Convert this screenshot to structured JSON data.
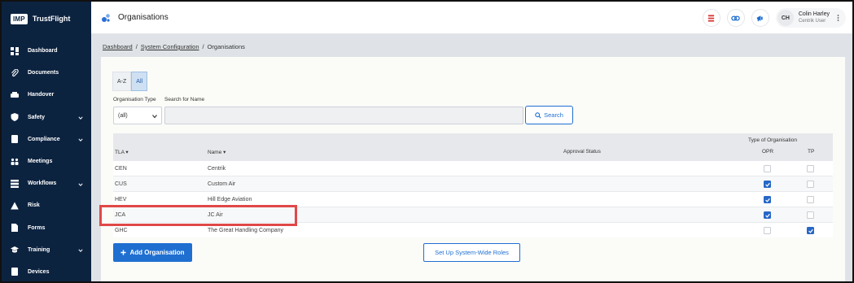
{
  "brand": {
    "logo": "IMP",
    "name": "TrustFlight"
  },
  "sidebar": {
    "items": [
      {
        "label": "Dashboard",
        "icon": "dashboard-icon",
        "expandable": false
      },
      {
        "label": "Documents",
        "icon": "paperclip-icon",
        "expandable": false
      },
      {
        "label": "Handover",
        "icon": "handover-icon",
        "expandable": false
      },
      {
        "label": "Safety",
        "icon": "shield-icon",
        "expandable": true
      },
      {
        "label": "Compliance",
        "icon": "compliance-icon",
        "expandable": true
      },
      {
        "label": "Meetings",
        "icon": "meetings-icon",
        "expandable": false
      },
      {
        "label": "Workflows",
        "icon": "workflows-icon",
        "expandable": true
      },
      {
        "label": "Risk",
        "icon": "risk-icon",
        "expandable": false
      },
      {
        "label": "Forms",
        "icon": "forms-icon",
        "expandable": false
      },
      {
        "label": "Training",
        "icon": "training-icon",
        "expandable": true
      },
      {
        "label": "Devices",
        "icon": "devices-icon",
        "expandable": false
      }
    ]
  },
  "header": {
    "title": "Organisations",
    "user": {
      "initials": "CH",
      "name": "Colin Harley",
      "role": "Centrik User"
    }
  },
  "breadcrumb": {
    "items": [
      "Dashboard",
      "System Configuration",
      "Organisations"
    ],
    "separator": "/"
  },
  "filters": {
    "az_label": "A-Z",
    "all_label": "All",
    "org_type_label": "Organisation Type",
    "org_type_value": "(all)",
    "search_label": "Search for Name",
    "search_value": "",
    "search_button": "Search"
  },
  "table": {
    "group_header": "Type of Organisation",
    "columns": {
      "tla": "TLA ▾",
      "name": "Name ▾",
      "approval": "Approval Status",
      "opr": "OPR",
      "tp": "TP"
    },
    "rows": [
      {
        "tla": "CEN",
        "name": "Centrik",
        "approval": "",
        "opr": false,
        "tp": false
      },
      {
        "tla": "CUS",
        "name": "Custom Air",
        "approval": "",
        "opr": true,
        "tp": false
      },
      {
        "tla": "HEV",
        "name": "Hill Edge Aviation",
        "approval": "",
        "opr": true,
        "tp": false
      },
      {
        "tla": "JCA",
        "name": "JC Air",
        "approval": "",
        "opr": true,
        "tp": false
      },
      {
        "tla": "GHC",
        "name": "The Great Handling Company",
        "approval": "",
        "opr": false,
        "tp": true
      }
    ]
  },
  "actions": {
    "add_label": "Add Organisation",
    "roles_label": "Set Up System-Wide Roles"
  },
  "colors": {
    "sidebar": "#0c2340",
    "primary": "#1f6fd1",
    "highlight": "#e04848"
  }
}
